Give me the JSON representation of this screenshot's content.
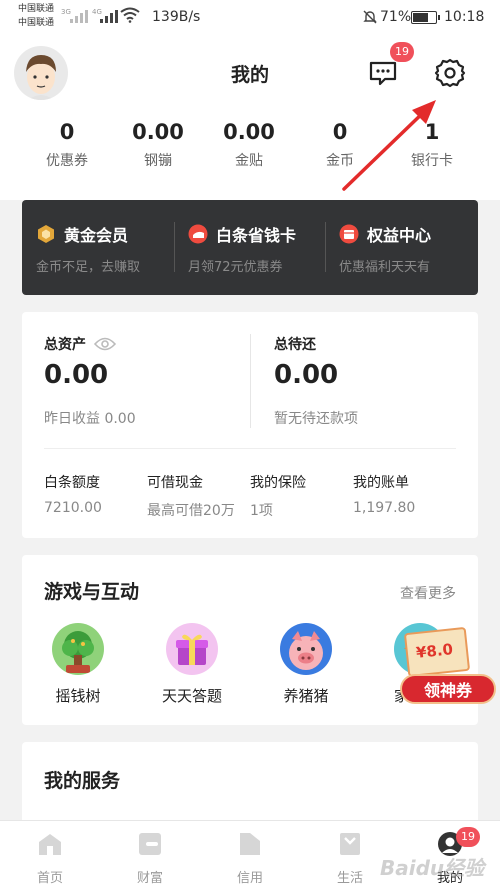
{
  "status_bar": {
    "carrier1": "中国联通",
    "carrier2": "中国联通",
    "net1": "3G",
    "net2": "4G",
    "speed": "139B/s",
    "battery_pct": "71%",
    "battery_level": 0.71,
    "time": "10:18"
  },
  "header": {
    "title": "我的",
    "message_badge": "19"
  },
  "stats": [
    {
      "value": "0",
      "label": "优惠券"
    },
    {
      "value": "0.00",
      "label": "钢镚"
    },
    {
      "value": "0.00",
      "label": "金贴"
    },
    {
      "value": "0",
      "label": "金币"
    },
    {
      "value": "1",
      "label": "银行卡"
    }
  ],
  "member": [
    {
      "title": "黄金会员",
      "subtitle": "金币不足，去赚取",
      "icon": "gold-member-icon",
      "color": "#e3a73a"
    },
    {
      "title": "白条省钱卡",
      "subtitle": "月领72元优惠券",
      "icon": "baitiao-card-icon",
      "color": "#ef4b3f"
    },
    {
      "title": "权益中心",
      "subtitle": "优惠福利天天有",
      "icon": "benefit-center-icon",
      "color": "#ef4b3f"
    }
  ],
  "assets": {
    "total_label": "总资产",
    "total_value": "0.00",
    "yesterday": "昨日收益 0.00",
    "pending_label": "总待还",
    "pending_value": "0.00",
    "pending_sub": "暂无待还款项",
    "quick": [
      {
        "title": "白条额度",
        "value": "7210.00"
      },
      {
        "title": "可借现金",
        "value": "最高可借20万"
      },
      {
        "title": "我的保险",
        "value": "1项"
      },
      {
        "title": "我的账单",
        "value": "1,197.80"
      }
    ]
  },
  "games": {
    "title": "游戏与互动",
    "more": "查看更多",
    "items": [
      {
        "label": "摇钱树",
        "icon": "money-tree-icon"
      },
      {
        "label": "天天答题",
        "icon": "gift-box-icon"
      },
      {
        "label": "养猪猪",
        "icon": "pig-icon"
      },
      {
        "label": "家",
        "icon": "home-game-icon"
      }
    ],
    "coupon_amount": "¥8.0",
    "coupon_button": "领神券"
  },
  "services": {
    "title": "我的服务"
  },
  "tabs": [
    {
      "label": "首页",
      "icon": "home-icon"
    },
    {
      "label": "财富",
      "icon": "wealth-icon"
    },
    {
      "label": "信用",
      "icon": "credit-icon"
    },
    {
      "label": "生活",
      "icon": "life-icon"
    },
    {
      "label": "我的",
      "icon": "profile-icon"
    }
  ],
  "tab_badge": "19",
  "watermark": "Baidu经验",
  "colors": {
    "accent_red": "#f0505a",
    "dark_card": "#333436",
    "page_bg": "#f2f2f2"
  }
}
